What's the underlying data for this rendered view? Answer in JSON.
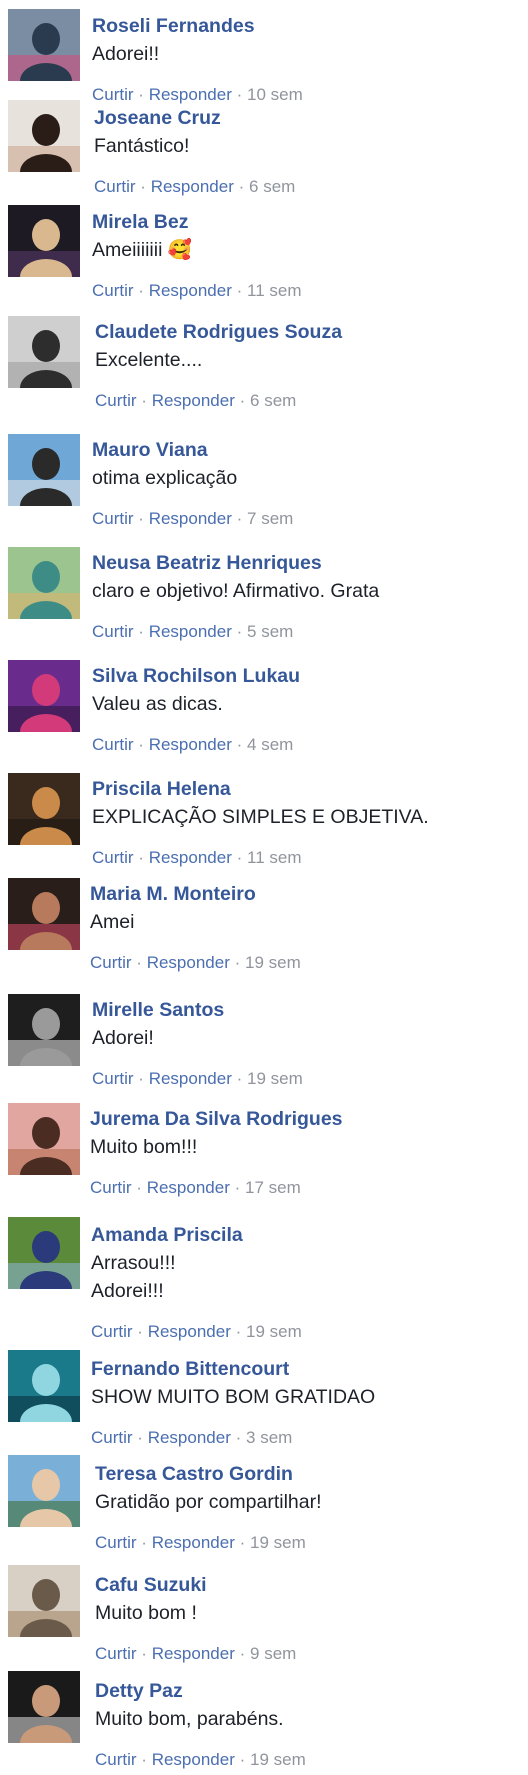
{
  "actions": {
    "like": "Curtir",
    "reply": "Responder",
    "separator": "·"
  },
  "comments": [
    {
      "name": "Roseli Fernandes",
      "text": "Adorei!!",
      "time": "10 sem",
      "avatar_icon": "avatar-photo",
      "avatar_colors": [
        "#7a8da3",
        "#2b3b4f",
        "#d7487a"
      ]
    },
    {
      "name": "Joseane Cruz",
      "text": "Fantástico!",
      "time": "6 sem",
      "avatar_icon": "avatar-photo",
      "avatar_colors": [
        "#e8e2dc",
        "#2a1d17",
        "#c9a48a"
      ]
    },
    {
      "name": "Mirela Bez",
      "text": "Ameiiiiiii 🥰",
      "time": "11 sem",
      "avatar_icon": "avatar-photo",
      "avatar_colors": [
        "#1d1a24",
        "#d9b88f",
        "#5b3a6e"
      ]
    },
    {
      "name": "Claudete Rodrigues Souza",
      "text": "Excelente....",
      "time": "6 sem",
      "avatar_icon": "avatar-photo",
      "avatar_colors": [
        "#cfcfcf",
        "#2d2d2d",
        "#9a9a9a"
      ]
    },
    {
      "name": "Mauro Viana",
      "text": "otima explicação",
      "time": "7 sem",
      "avatar_icon": "avatar-photo",
      "avatar_colors": [
        "#6fa7d6",
        "#2a2a2a",
        "#e8e8e8"
      ]
    },
    {
      "name": "Neusa Beatriz Henriques",
      "text": "claro e objetivo! Afirmativo. Grata",
      "time": "5 sem",
      "avatar_icon": "avatar-photo",
      "avatar_colors": [
        "#9cc48e",
        "#3e8c86",
        "#e0b36a"
      ]
    },
    {
      "name": "Silva Rochilson Lukau",
      "text": "Valeu as dicas.",
      "time": "4 sem",
      "avatar_icon": "avatar-photo",
      "avatar_colors": [
        "#6a2c8c",
        "#d23a7a",
        "#2a1638"
      ]
    },
    {
      "name": "Priscila Helena",
      "text": "EXPLICAÇÃO SIMPLES E OBJETIVA.",
      "time": "11 sem",
      "avatar_icon": "avatar-photo",
      "avatar_colors": [
        "#3a2a1e",
        "#c98a4a",
        "#1b1410"
      ]
    },
    {
      "name": "Maria M. Monteiro",
      "text": "Amei",
      "time": "19 sem",
      "avatar_icon": "avatar-photo",
      "avatar_colors": [
        "#2a1e1a",
        "#b77a5c",
        "#d84a6a"
      ]
    },
    {
      "name": "Mirelle Santos",
      "text": "Adorei!",
      "time": "19 sem",
      "avatar_icon": "avatar-photo",
      "avatar_colors": [
        "#1e1e1e",
        "#9a9a9a",
        "#e6e6e6"
      ]
    },
    {
      "name": "Jurema Da Silva Rodrigues",
      "text": "Muito bom!!!",
      "time": "17 sem",
      "avatar_icon": "avatar-photo",
      "avatar_colors": [
        "#e2a6a0",
        "#4a2c22",
        "#b06a4a"
      ]
    },
    {
      "name": "Amanda Priscila",
      "text": "Arrasou!!!\nAdorei!!!",
      "time": "19 sem",
      "avatar_icon": "avatar-photo",
      "avatar_colors": [
        "#5a8a3a",
        "#2a3a7a",
        "#8fb6d8"
      ]
    },
    {
      "name": "Fernando Bittencourt",
      "text": "SHOW MUITO BOM GRATIDAO",
      "time": "3 sem",
      "avatar_icon": "avatar-photo",
      "avatar_colors": [
        "#1a7a8a",
        "#8fd6e0",
        "#0a2a3a"
      ]
    },
    {
      "name": "Teresa Castro Gordin",
      "text": "Gratidão por compartilhar!",
      "time": "19 sem",
      "avatar_icon": "avatar-photo",
      "avatar_colors": [
        "#7ab0d8",
        "#e6c8a8",
        "#3a6a2a"
      ]
    },
    {
      "name": "Cafu Suzuki",
      "text": "Muito bom !",
      "time": "9 sem",
      "avatar_icon": "avatar-photo",
      "avatar_colors": [
        "#d8d0c4",
        "#6a5a4a",
        "#a08060"
      ]
    },
    {
      "name": "Detty Paz",
      "text": "Muito bom, parabéns.",
      "time": "19 sem",
      "avatar_icon": "avatar-photo",
      "avatar_colors": [
        "#1a1a1a",
        "#c89a7a",
        "#e0e0e0"
      ]
    }
  ]
}
